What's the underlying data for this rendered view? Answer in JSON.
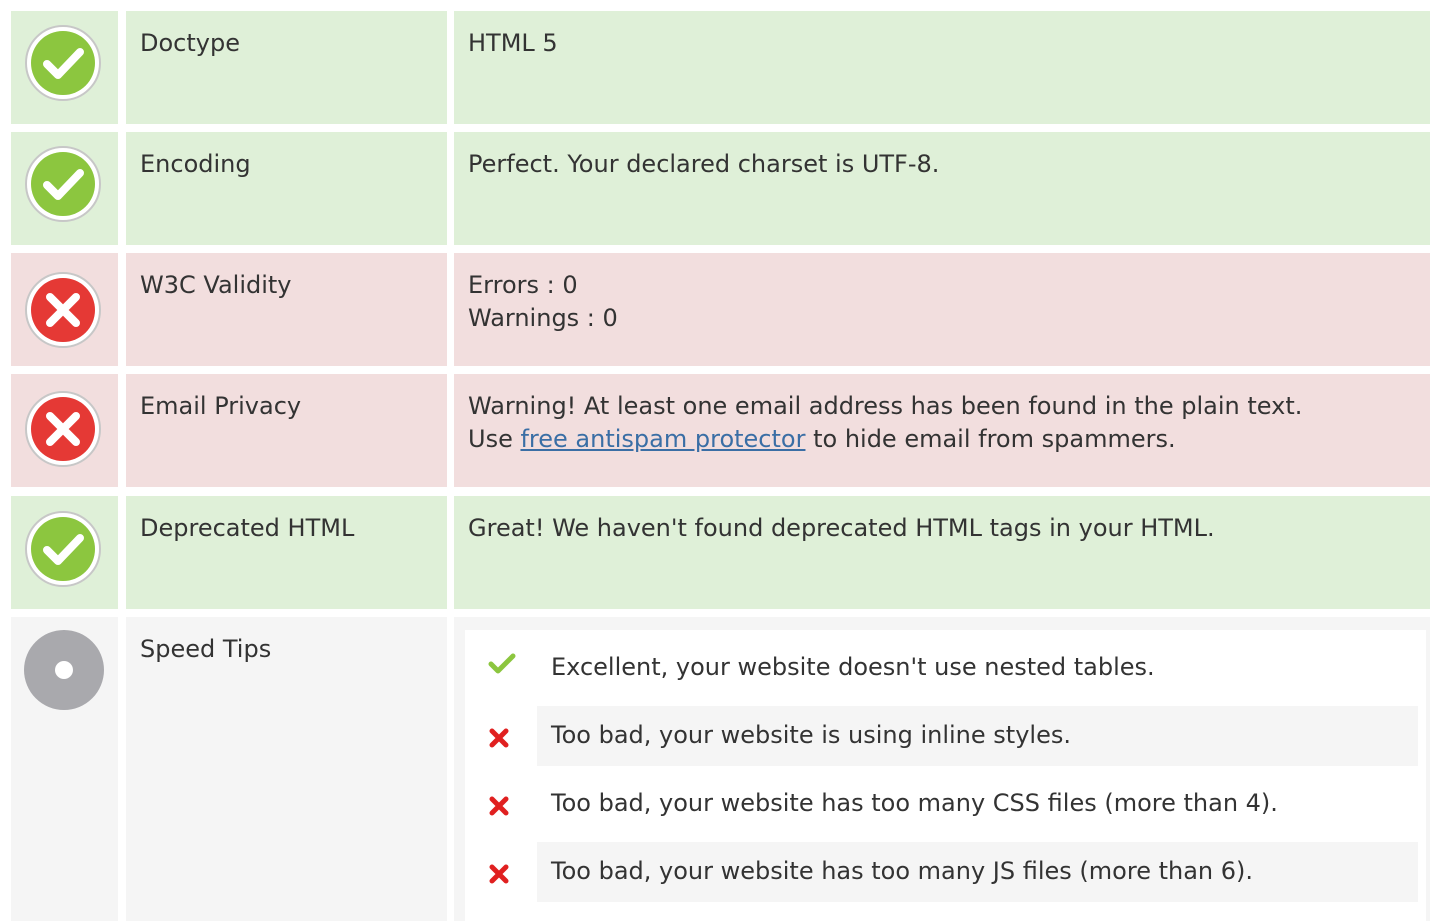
{
  "colors": {
    "ok_bg": "#dff0d8",
    "error_bg": "#f2dede",
    "neutral_bg": "#f5f5f5",
    "ok_icon": "#8cc63f",
    "error_icon": "#e53935",
    "neutral_icon": "#a9a9ad",
    "link": "#3a6ea5"
  },
  "rows": [
    {
      "status": "ok",
      "icon": "check-circle-icon",
      "label": "Doctype",
      "value": "HTML 5"
    },
    {
      "status": "ok",
      "icon": "check-circle-icon",
      "label": "Encoding",
      "value": "Perfect. Your declared charset is UTF-8."
    },
    {
      "status": "error",
      "icon": "cross-circle-icon",
      "label": "W3C Validity",
      "value_lines": [
        "Errors : 0",
        "Warnings : 0"
      ]
    },
    {
      "status": "error",
      "icon": "cross-circle-icon",
      "label": "Email Privacy",
      "value_line1": "Warning! At least one email address has been found in the plain text.",
      "value_prefix": "Use ",
      "value_link": "free antispam protector",
      "value_suffix": " to hide email from spammers."
    },
    {
      "status": "ok",
      "icon": "check-circle-icon",
      "label": "Deprecated HTML",
      "value": "Great! We haven't found deprecated HTML tags in your HTML."
    },
    {
      "status": "neutral",
      "icon": "neutral-circle-icon",
      "label": "Speed Tips",
      "tips": [
        {
          "status": "pass",
          "icon": "checkmark-icon",
          "text": "Excellent, your website doesn't use nested tables."
        },
        {
          "status": "fail",
          "icon": "cross-icon",
          "text": "Too bad, your website is using inline styles."
        },
        {
          "status": "fail",
          "icon": "cross-icon",
          "text": "Too bad, your website has too many CSS files (more than 4)."
        },
        {
          "status": "fail",
          "icon": "cross-icon",
          "text": "Too bad, your website has too many JS files (more than 6)."
        }
      ]
    }
  ]
}
